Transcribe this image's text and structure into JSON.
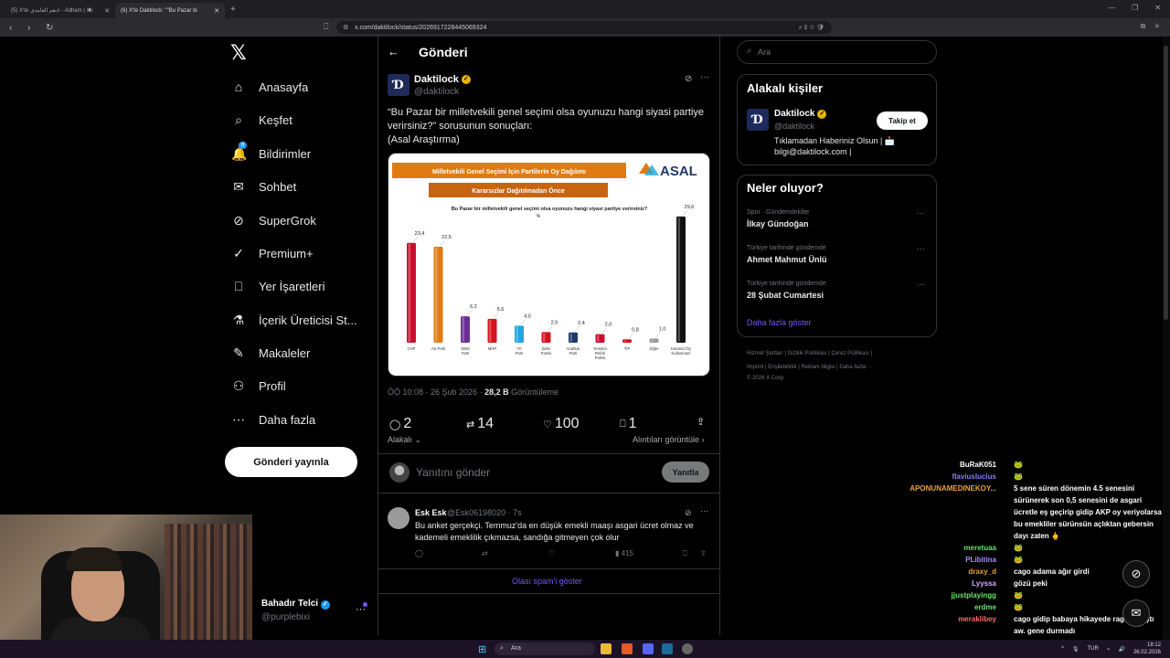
{
  "browser": {
    "tabs": [
      {
        "label": "(5) X'te ادهم العامدي - Adham | 🏴‍☠️"
      },
      {
        "label": "(6) X'te Daktilock: \"\"Bu Pazar bi"
      }
    ],
    "url": "x.com/daktilock/status/2026917228445069324"
  },
  "nav": {
    "logo": "𝕏",
    "items": [
      {
        "label": "Anasayfa",
        "icon": "home-icon",
        "glyph": "⌂"
      },
      {
        "label": "Keşfet",
        "icon": "search-icon",
        "glyph": "⌕"
      },
      {
        "label": "Bildirimler",
        "icon": "bell-icon",
        "glyph": "🔔",
        "badge": "6"
      },
      {
        "label": "Sohbet",
        "icon": "mail-icon",
        "glyph": "✉"
      },
      {
        "label": "SuperGrok",
        "icon": "grok-icon",
        "glyph": "⊘"
      },
      {
        "label": "Premium+",
        "icon": "premium-icon",
        "glyph": "✓"
      },
      {
        "label": "Yer İşaretleri",
        "icon": "bookmark-icon",
        "glyph": "⎕"
      },
      {
        "label": "İçerik Üreticisi St...",
        "icon": "studio-icon",
        "glyph": "⚗"
      },
      {
        "label": "Makaleler",
        "icon": "article-icon",
        "glyph": "✎"
      },
      {
        "label": "Profil",
        "icon": "person-icon",
        "glyph": "⚇"
      },
      {
        "label": "Daha fazla",
        "icon": "more-circle-icon",
        "glyph": "⋯"
      }
    ],
    "post_button": "Gönderi yayınla",
    "account_name": "Bahadır Telci",
    "account_handle": "@purplebixi"
  },
  "post": {
    "header_title": "Gönderi",
    "author_name": "Daktilock",
    "author_handle": "@daktilock",
    "text_line1": "“Bu Pazar bir milletvekili genel seçimi olsa oyunuzu hangi siyasi partiye",
    "text_line2": "verirsiniz?” sorusunun sonuçları:",
    "text_line3": "(Asal Araştırma)",
    "time": "ÖÖ 10:08 · 26 Şub 2026 · ",
    "views_count": "28,2 B",
    "views_label": " Görüntüleme",
    "replies": "2",
    "reposts": "14",
    "likes": "100",
    "bookmarks": "1",
    "sort_label": "Alakalı",
    "quotes_label": "Alıntıları görüntüle",
    "reply_placeholder": "Yanıtını gönder",
    "reply_button": "Yanıtla"
  },
  "chart_data": {
    "type": "bar",
    "banner1": "Milletvekili Genel Seçimi İçin Partilerin Oy Dağılımı",
    "banner2": "Kararsızlar Dağıtılmadan Önce",
    "logo": "ASAL",
    "title": "Bu Pazar bir milletvekili genel seçimi olsa oyunuzu hangi siyasi partiye verirsiniz?",
    "unit": "%",
    "categories": [
      "CHP",
      "AK Parti",
      "DEM Parti",
      "MHP",
      "İYİ Parti",
      "Zafer Partisi",
      "Anahtar Parti",
      "Yeniden Refah Partisi",
      "TİP",
      "Diğer",
      "Kararsız/Oy Kullanmam"
    ],
    "values": [
      23.4,
      22.5,
      6.2,
      5.6,
      4.0,
      2.5,
      2.4,
      2.0,
      0.8,
      1.0,
      29.6
    ],
    "value_labels": [
      "23,4",
      "22,5",
      "6,2",
      "5,6",
      "4,0",
      "2,5",
      "2,4",
      "2,0",
      "0,8",
      "1,0",
      "29,6"
    ],
    "colors": [
      "#c8102e",
      "#e07b12",
      "#6a2d91",
      "#d4131b",
      "#1ea7e0",
      "#d4131b",
      "#1f3a6b",
      "#c8102e",
      "#d4131b",
      "#9a9a9a",
      "#111111"
    ],
    "ylim": [
      0,
      30
    ]
  },
  "comment": {
    "name": "Esk Esk",
    "handle": "@Esk06198020 · 7s",
    "text": "Bu anket gerçekçi. Temmuz'da en düşük emekli maaşı asgari ücret olmaz ve kademeli emeklilik çıkmazsa, sandığa gitmeyen çok olur",
    "views": "415",
    "spam_link": "Olası spam'i göster"
  },
  "sidebar": {
    "search_placeholder": "Ara",
    "related_title": "Alakalı kişiler",
    "related_name": "Daktilock",
    "related_handle": "@daktilock",
    "follow_button": "Takip et",
    "related_bio_1": "Tıklamadan Haberiniz Olsun | 📩",
    "related_bio_2": "bilgi@daktilock.com |",
    "trends_title": "Neler oluyor?",
    "trends": [
      {
        "category": "Spor · Gündemdekiler",
        "name": "İlkay Gündoğan"
      },
      {
        "category": "Türkiye tarihinde gündemde",
        "name": "Ahmet Mahmut Ünlü"
      },
      {
        "category": "Türkiye tarihinde gündemde",
        "name": "28 Şubat Cumartesi"
      }
    ],
    "show_more": "Daha fazla göster",
    "footer_1": "Hizmet Şartları  |  Gizlilik Politikası  |  Çerez Politikası  |",
    "footer_2": "Imprint  |  Erişilebilirlik  |  Reklam bilgisi  |  Daha fazla ···",
    "footer_3": "© 2026 X Corp."
  },
  "chat": [
    {
      "user": "BuRaK051",
      "text": "🐸",
      "color": "#ffffff"
    },
    {
      "user": "flaviuslucius",
      "text": "🐸",
      "color": "#8c7bff"
    },
    {
      "user": "APONUNAMEDINEKOY...",
      "text": "5 sene süren dönemin 4.5 senesini sürünerek son 0,5 senesini de asgari ücretle eş geçirip gidip AKP oy veriyolarsa bu emekliler sürünsün açlıktan gebersin dayı zaten 🖕",
      "color": "#e8a33a"
    },
    {
      "user": "meretuaa",
      "text": "🐸",
      "color": "#6ee06e"
    },
    {
      "user": "PLibitina",
      "text": "🐸",
      "color": "#a58cff"
    },
    {
      "user": "draxy_d",
      "text": "cago adama ağır girdi",
      "color": "#e8a33a"
    },
    {
      "user": "Lyyssa",
      "text": "gözü peki",
      "color": "#d7a6ff"
    },
    {
      "user": "jjustplayingg",
      "text": "🐸",
      "color": "#6ee06e"
    },
    {
      "user": "erdme",
      "text": "🐸",
      "color": "#6ee06e"
    },
    {
      "user": "meraklibey",
      "text": "cago gidip babaya hikayede rage atmıştı aw. gene durmadı",
      "color": "#ff6a6a"
    }
  ],
  "taskbar": {
    "search": "Ara",
    "lang": "TUR",
    "time": "18:12",
    "date": "26.02.2026"
  }
}
